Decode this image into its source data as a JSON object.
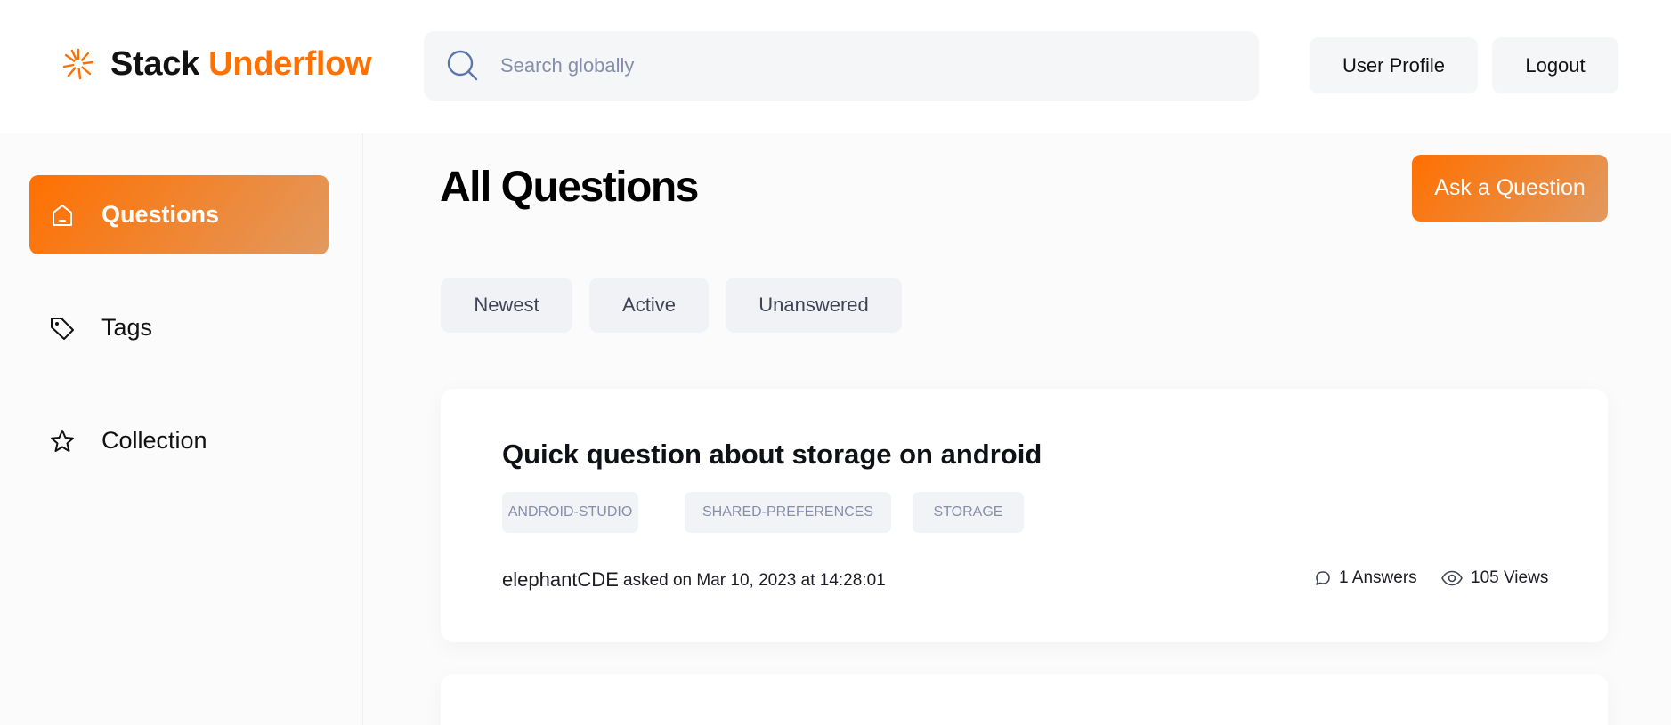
{
  "header": {
    "logo_part1": "Stack",
    "logo_part2": "Underflow",
    "search_placeholder": "Search globally",
    "user_profile_label": "User Profile",
    "logout_label": "Logout"
  },
  "sidebar": {
    "items": [
      {
        "label": "Questions",
        "icon": "home-icon",
        "active": true
      },
      {
        "label": "Tags",
        "icon": "tag-icon",
        "active": false
      },
      {
        "label": "Collection",
        "icon": "star-icon",
        "active": false
      }
    ]
  },
  "main": {
    "title": "All Questions",
    "ask_button": "Ask a Question",
    "filters": [
      "Newest",
      "Active",
      "Unanswered"
    ],
    "questions": [
      {
        "title": "Quick question about storage on android",
        "tags": [
          "ANDROID-STUDIO",
          "SHARED-PREFERENCES",
          "STORAGE"
        ],
        "author": "elephantCDE",
        "asked": "asked on Mar 10, 2023 at 14:28:01",
        "answers": "1 Answers",
        "views": "105 Views"
      }
    ]
  },
  "colors": {
    "accent": "#ff7000",
    "accent_gradient_end": "#e2995f",
    "surface": "#f4f6f8",
    "muted_text": "#858ead"
  }
}
